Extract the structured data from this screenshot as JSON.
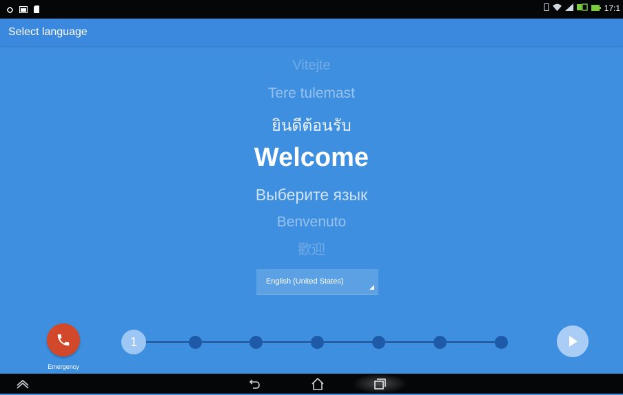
{
  "status_bar": {
    "time": "17:1",
    "left_icons": [
      "location-icon",
      "gallery-icon",
      "sd-card-icon"
    ],
    "right_icons": [
      "vibrate-icon",
      "wifi-icon",
      "signal-icon",
      "data-icon",
      "battery-icon"
    ]
  },
  "app_bar": {
    "title": "Select language"
  },
  "languages": [
    "Vitejte",
    "Tere tulemast",
    "ยินดีต้อนรับ",
    "Welcome",
    "Выберите язык",
    "Benvenuto",
    "歡迎"
  ],
  "language_select": {
    "selected": "English (United States)"
  },
  "emergency": {
    "label": "Emergency"
  },
  "progress": {
    "current_step": "1",
    "total_steps": 7
  },
  "colors": {
    "background": "#3f8fe0",
    "emergency": "#d2482a",
    "progress_dot": "#1e5aa8"
  },
  "nav_bar": {
    "icons": [
      "screenshot-icon",
      "back-icon",
      "home-icon",
      "recent-apps-icon"
    ]
  }
}
